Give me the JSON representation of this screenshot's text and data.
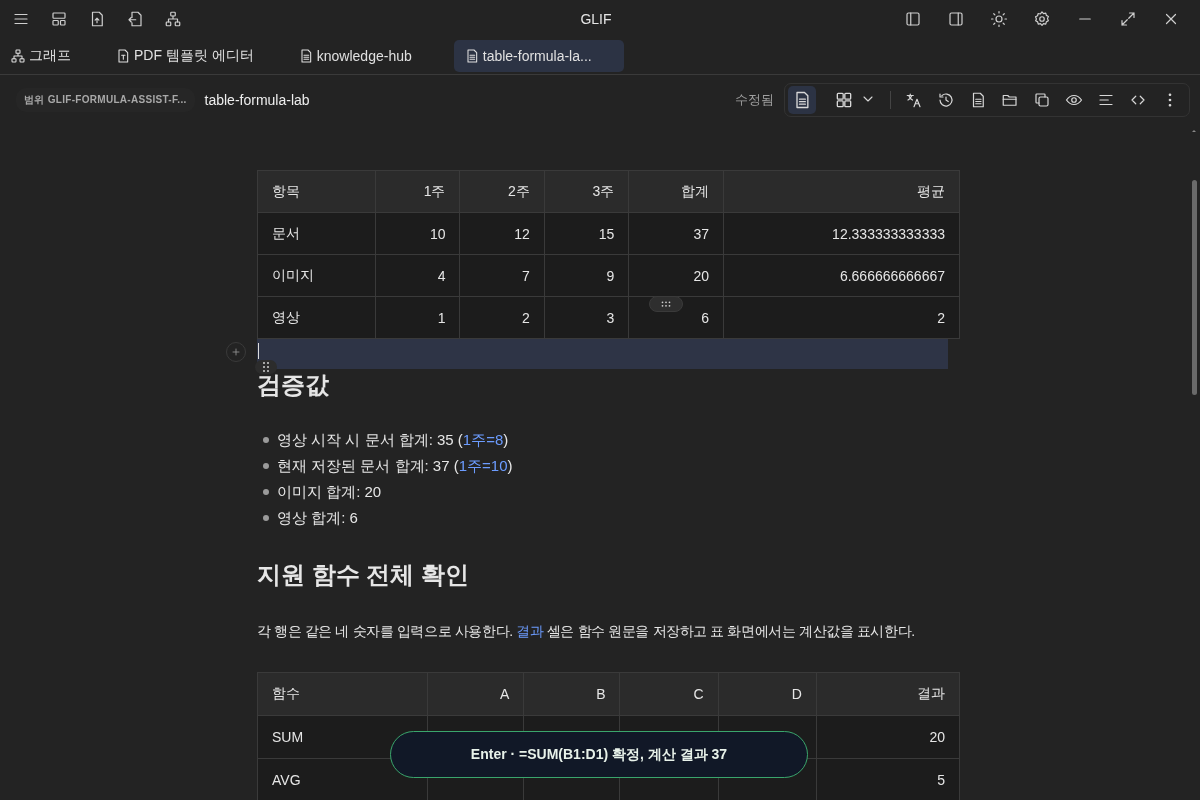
{
  "window": {
    "title": "GLIF"
  },
  "tabs": [
    {
      "label": "그래프",
      "kind": "graph",
      "selected": false
    },
    {
      "label": "PDF 템플릿 에디터",
      "kind": "pdf",
      "selected": false
    },
    {
      "label": "knowledge-hub",
      "kind": "doc",
      "selected": false
    },
    {
      "label": "table-formula-la...",
      "kind": "doc",
      "selected": true
    }
  ],
  "breadcrumb": {
    "scope": "범위 GLIF-FORMULA-ASSIST-F...",
    "title": "table-formula-lab"
  },
  "toolbar": {
    "status": "수정됨",
    "view_modes": [
      {
        "selected": true
      },
      {
        "selected": false
      }
    ]
  },
  "table_1": {
    "columns": [
      "항목",
      "1주",
      "2주",
      "3주",
      "합계",
      "평균"
    ],
    "rows": [
      [
        "문서",
        "10",
        "12",
        "15",
        "37",
        "12.333333333333"
      ],
      [
        "이미지",
        "4",
        "7",
        "9",
        "20",
        "6.666666666667"
      ],
      [
        "영상",
        "1",
        "2",
        "3",
        "6",
        "2"
      ]
    ]
  },
  "section_1": {
    "heading": "검증값",
    "items": [
      {
        "text": "영상 시작 시 문서 합계: 35 (",
        "link": "1주=8",
        "after": ")"
      },
      {
        "text": "현재 저장된 문서 합계: 37 (",
        "link": "1주=10",
        "after": ")"
      },
      {
        "text": "이미지 합계: 20"
      },
      {
        "text": "영상 합계: 6"
      }
    ]
  },
  "section_2": {
    "heading": "지원 함수 전체 확인",
    "paragraph": {
      "text": "각 행은 같은 네 숫자를 입력으로 사용한다.",
      "link": "결과",
      "after": "셀은 함수 원문을 저장하고 표 화면에서는 계산값을 표시한다."
    }
  },
  "table_2": {
    "columns": [
      "함수",
      "A",
      "B",
      "C",
      "D",
      "결과"
    ],
    "rows": [
      {
        "name": "SUM",
        "result": "20"
      },
      {
        "name": "AVG",
        "result": "5"
      }
    ]
  },
  "toast": "Enter · =SUM(B1:D1) 확정, 계산 결과 37"
}
